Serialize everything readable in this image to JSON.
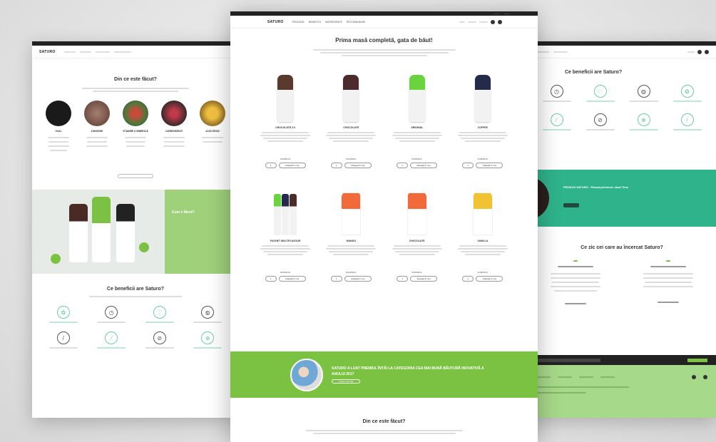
{
  "center": {
    "logo": "SATURO",
    "nav": [
      "PRODUSE",
      "BENEFICII",
      "INGREDIENTE",
      "RECOMANDARI"
    ],
    "title": "Prima masă completă, gata de băut!",
    "qty_label": "NUMĂRUL",
    "buy_label": "Adaugă în coș",
    "products": [
      {
        "name": "CHOCOLATE 2.0",
        "color": "#5a3a2e",
        "body": "#f2f2f2"
      },
      {
        "name": "CHOCOLATE",
        "color": "#4b2b2c",
        "body": "#f2f2f2"
      },
      {
        "name": "ORIGINAL",
        "color": "#6bd33d",
        "body": "#f2f2f2"
      },
      {
        "name": "COFFEE",
        "color": "#242a4a",
        "body": "#f2f2f2"
      },
      {
        "name": "PACHET MULTIFLAVOUR",
        "color": "multi",
        "body": "#f2f2f2"
      },
      {
        "name": "MANGO",
        "color": "#f26a3a",
        "body": "#fff"
      },
      {
        "name": "CHOCOLATE",
        "color": "#f26a3a",
        "body": "#fff"
      },
      {
        "name": "VANILLA",
        "color": "#f1c232",
        "body": "#fff"
      }
    ],
    "award_text": "SATURO A LUAT PREMIUL ÎNTÂI LA CATEGORIA CEA MAI BUNĂ BĂUTURĂ INOVATIVĂ A ANULUI 2017",
    "award_btn": "Citește mai mult",
    "bottom_title": "Din ce este făcut?"
  },
  "left": {
    "logo": "SATURO",
    "title": "Din ce este făcut?",
    "ingredients": [
      {
        "label": "OUAL",
        "color": "#1a1a1a"
      },
      {
        "label": "ZAHARURI",
        "color": "#8a6a5a"
      },
      {
        "label": "VITAMINE & MINERALE",
        "color": "#6a3a2a"
      },
      {
        "label": "CARBOHIDRATI",
        "color": "#3a2a2a"
      },
      {
        "label": "ACIZI GRAȘI",
        "color": "#c89a3a"
      }
    ],
    "green_panel": "Cum e făcut?",
    "benefits_title": "Ce beneficii are Saturo?"
  },
  "right": {
    "logo": "SATURO",
    "title": "Ce beneficii are Saturo?",
    "band_text": "PRODUS SATURO - Pleacă prietenul; Ideal Time",
    "testi_title": "Ce zic cei care au încercat Saturo?"
  }
}
